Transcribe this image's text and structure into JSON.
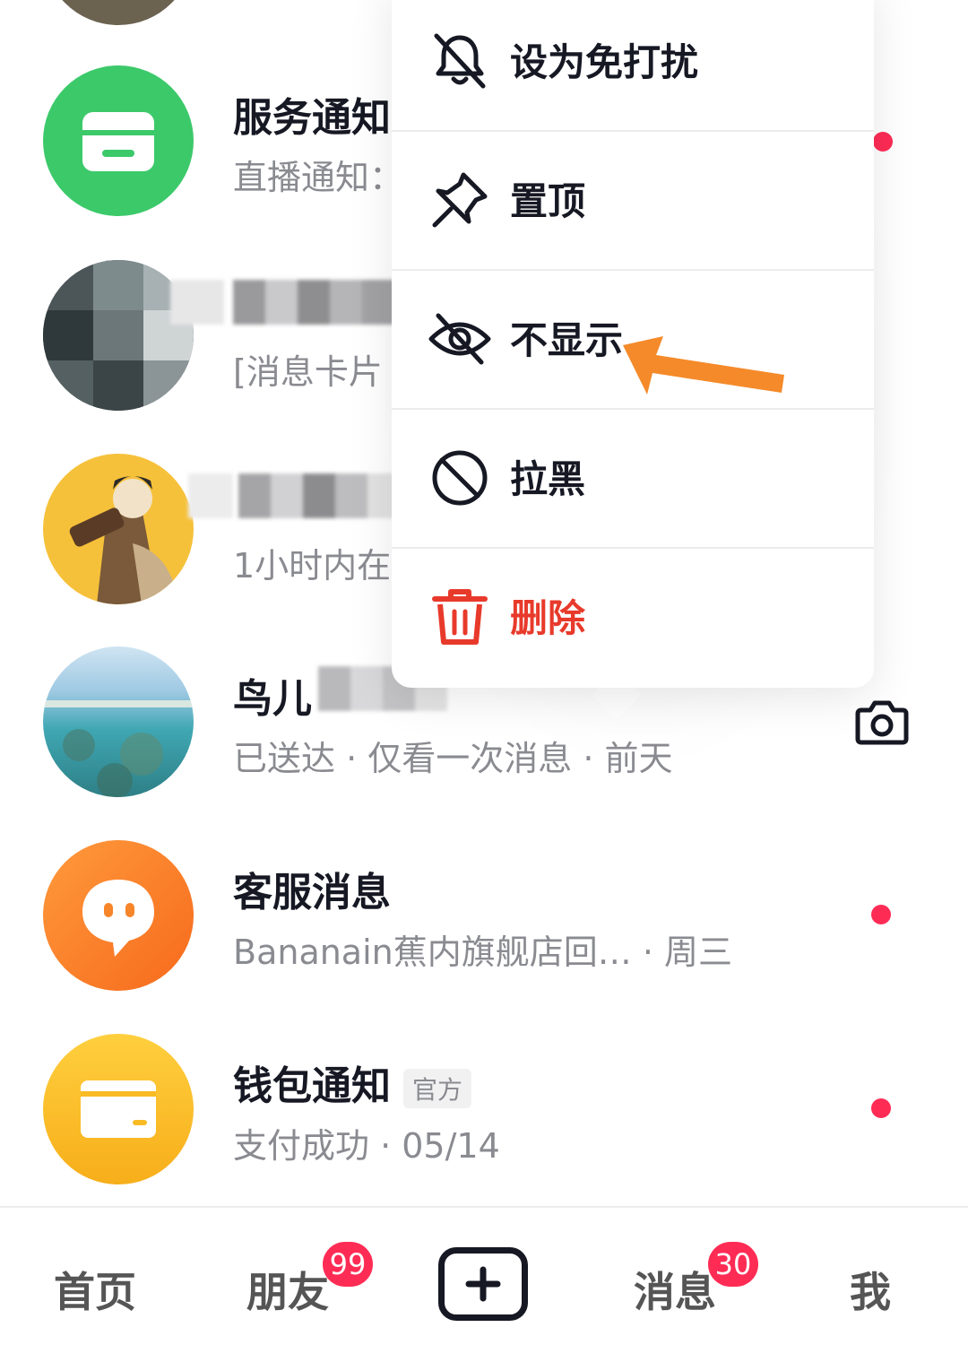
{
  "conversations": [
    {
      "name": "服务通知",
      "preview": "直播通知：",
      "unread": true
    },
    {
      "name": "",
      "preview": "[消息卡片"
    },
    {
      "name": "",
      "preview": "1小时内在"
    },
    {
      "name": "鸟儿",
      "preview": "已送达 · 仅看一次消息 · 前天"
    },
    {
      "name": "客服消息",
      "preview": "Bananain蕉内旗舰店回…  · 周三",
      "unread": true
    },
    {
      "name": "钱包通知",
      "tag": "官方",
      "preview": "支付成功 · 05/14",
      "unread": true
    }
  ],
  "context_menu": {
    "items": [
      {
        "label": "设为免打扰",
        "icon": "bell-off-icon"
      },
      {
        "label": "置顶",
        "icon": "pin-icon"
      },
      {
        "label": "不显示",
        "icon": "eye-off-icon"
      },
      {
        "label": "拉黑",
        "icon": "block-icon"
      },
      {
        "label": "删除",
        "icon": "trash-icon",
        "color": "#e83a2b"
      }
    ]
  },
  "nav": {
    "home": "首页",
    "friends": "朋友",
    "friends_badge": "99",
    "messages": "消息",
    "messages_badge": "30",
    "me": "我"
  },
  "colors": {
    "accent": "#fe2c55",
    "delete": "#e83a2b",
    "arrow": "#f58a2a"
  }
}
